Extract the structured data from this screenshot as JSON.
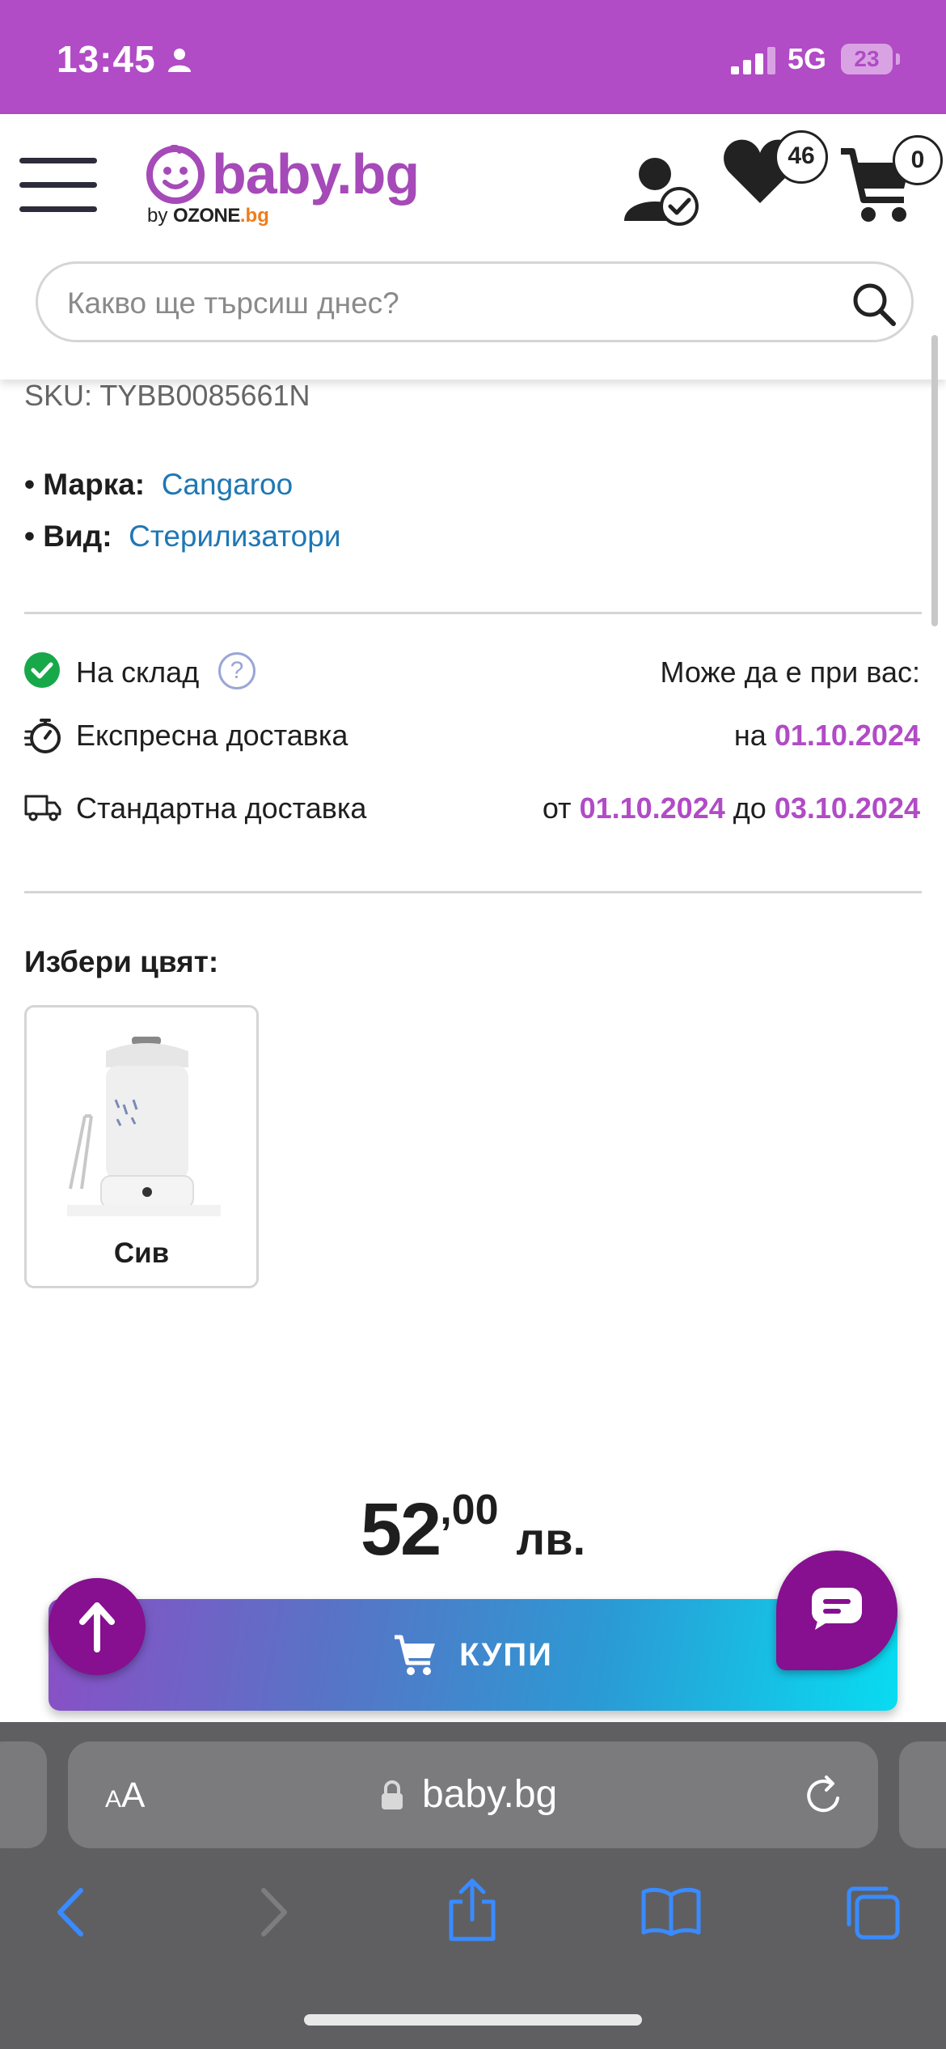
{
  "status_bar": {
    "time": "13:45",
    "network": "5G",
    "battery": "23"
  },
  "header": {
    "logo_text": "baby.bg",
    "logo_sub_by": "by",
    "logo_sub_brand": "OZONE",
    "logo_sub_tld": ".bg",
    "wishlist_count": "46",
    "cart_count": "0",
    "search_placeholder": "Какво ще търсиш днес?"
  },
  "product": {
    "sku": "SKU: TYBB0085661N",
    "attributes": [
      {
        "label": "Марка:",
        "value": "Cangaroo"
      },
      {
        "label": "Вид:",
        "value": "Стерилизатори"
      }
    ]
  },
  "availability": {
    "stock_label": "На склад",
    "help": "?",
    "header_right": "Може да е при вас:",
    "express": {
      "label": "Експресна доставка",
      "prefix": "на",
      "date": "01.10.2024"
    },
    "standard": {
      "label": "Стандартна доставка",
      "from_word": "от",
      "from_date": "01.10.2024",
      "to_word": "до",
      "to_date": "03.10.2024"
    }
  },
  "colors": {
    "title": "Избери цвят:",
    "options": [
      {
        "label": "Сив"
      }
    ]
  },
  "price": {
    "integer": "52",
    "decimal": ",00",
    "currency": "лв."
  },
  "buy_button": {
    "label": "КУПИ"
  },
  "browser": {
    "aa_small": "A",
    "aa_big": "A",
    "url": "baby.bg"
  },
  "theme": {
    "brand_purple": "#b14bc6",
    "link_blue": "#1f77b4",
    "stock_green": "#17a84a",
    "fab_purple": "#86108f"
  }
}
